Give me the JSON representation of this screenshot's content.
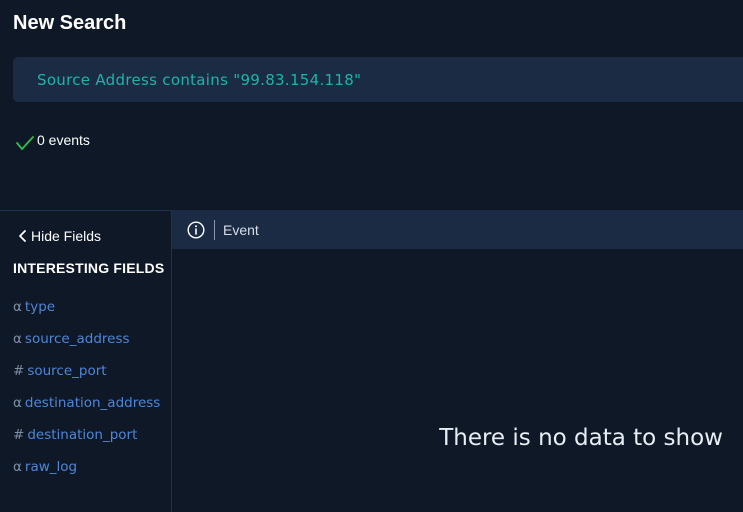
{
  "page": {
    "title": "New Search"
  },
  "search": {
    "query": "Source Address contains \"99.83.154.118\""
  },
  "status": {
    "icon": "check-icon",
    "text": "0 events",
    "color": "#2fbf4a"
  },
  "sidebar": {
    "toggle_label": "Hide Fields",
    "section_title": "INTERESTING FIELDS",
    "fields": [
      {
        "type": "α",
        "name": "type"
      },
      {
        "type": "α",
        "name": "source_address"
      },
      {
        "type": "#",
        "name": "source_port"
      },
      {
        "type": "α",
        "name": "destination_address"
      },
      {
        "type": "#",
        "name": "destination_port"
      },
      {
        "type": "α",
        "name": "raw_log"
      }
    ]
  },
  "events": {
    "header_icon": "info-icon",
    "column_label": "Event",
    "empty_message": "There is no data to show"
  },
  "colors": {
    "background": "#0e1827",
    "panel": "#1b2b44",
    "query_text": "#1fb3a8",
    "field_link": "#4f86d6"
  }
}
